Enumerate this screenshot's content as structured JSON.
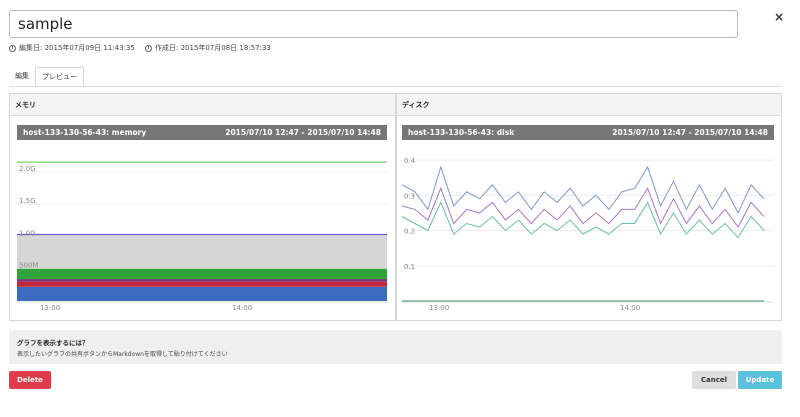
{
  "editor": {
    "title_value": "sample",
    "updated_label": "編集日: 2015年07月09日 11:43:35",
    "created_label": "作成日: 2015年07月08日 18:57:33"
  },
  "tabs": [
    {
      "label": "編集",
      "active": false
    },
    {
      "label": "プレビュー",
      "active": true
    }
  ],
  "panels": [
    {
      "header": "メモリ",
      "graph_title": "host-133-130-56-43: memory",
      "time_range": "2015/07/10 12:47 - 2015/07/10 14:48"
    },
    {
      "header": "ディスク",
      "graph_title": "host-133-130-56-43: disk",
      "time_range": "2015/07/10 12:47 - 2015/07/10 14:48"
    }
  ],
  "chart_data": [
    {
      "type": "area",
      "title": "host-133-130-56-43: memory",
      "y_ticks": [
        "500M",
        "1.0G",
        "1.5G",
        "2.0G"
      ],
      "x_ticks": [
        "13:00",
        "14:00"
      ],
      "ylim": [
        0,
        2.4
      ],
      "stacked": true,
      "series": [
        {
          "color": "#3a6cbf",
          "value": 0.22
        },
        {
          "color": "#c0283c",
          "value": 0.08
        },
        {
          "color": "#7a3a7a",
          "value": 0.04
        },
        {
          "color": "#2ea43a",
          "value": 0.16
        },
        {
          "color": "#d6d6d6",
          "value": 0.52
        },
        {
          "color": "#6a5acd",
          "value": 0.01,
          "line": true
        },
        {
          "color": "#7bd06a",
          "value": 2.15,
          "line": true
        }
      ]
    },
    {
      "type": "line",
      "title": "host-133-130-56-43: disk",
      "y_ticks": [
        "0.1",
        "0.2",
        "0.3",
        "0.4"
      ],
      "x_ticks": [
        "13:00",
        "14:00"
      ],
      "ylim": [
        0,
        0.44
      ],
      "series": [
        {
          "color": "#7d97c7",
          "values": [
            0.33,
            0.31,
            0.26,
            0.38,
            0.27,
            0.31,
            0.29,
            0.33,
            0.28,
            0.31,
            0.26,
            0.31,
            0.28,
            0.32,
            0.27,
            0.3,
            0.26,
            0.31,
            0.32,
            0.38,
            0.27,
            0.34,
            0.26,
            0.33,
            0.26,
            0.32,
            0.25,
            0.33,
            0.29
          ]
        },
        {
          "color": "#a878c0",
          "values": [
            0.27,
            0.26,
            0.23,
            0.32,
            0.22,
            0.26,
            0.25,
            0.28,
            0.23,
            0.26,
            0.22,
            0.26,
            0.23,
            0.27,
            0.22,
            0.25,
            0.22,
            0.26,
            0.26,
            0.32,
            0.22,
            0.29,
            0.22,
            0.27,
            0.22,
            0.26,
            0.21,
            0.28,
            0.24
          ]
        },
        {
          "color": "#6cbfa7",
          "values": [
            0.24,
            0.22,
            0.2,
            0.28,
            0.19,
            0.22,
            0.21,
            0.24,
            0.2,
            0.23,
            0.19,
            0.22,
            0.2,
            0.23,
            0.19,
            0.21,
            0.19,
            0.22,
            0.22,
            0.28,
            0.19,
            0.25,
            0.19,
            0.23,
            0.19,
            0.22,
            0.18,
            0.24,
            0.2
          ]
        },
        {
          "color": "#3a9a6a",
          "values": [
            0,
            0,
            0,
            0,
            0,
            0,
            0,
            0,
            0,
            0,
            0,
            0,
            0,
            0,
            0,
            0,
            0,
            0,
            0,
            0,
            0,
            0,
            0,
            0,
            0,
            0,
            0,
            0,
            0
          ]
        }
      ]
    }
  ],
  "help": {
    "title": "グラフを表示するには？",
    "text": "表示したいグラフの共有ボタンからMarkdownを取得して貼り付けてください"
  },
  "buttons": {
    "delete": "Delete",
    "cancel": "Cancel",
    "update": "Update"
  },
  "close_icon": "×",
  "colors": {
    "delete": "#e03c4e",
    "update": "#5bc0de",
    "graph_bar": "#777777"
  }
}
